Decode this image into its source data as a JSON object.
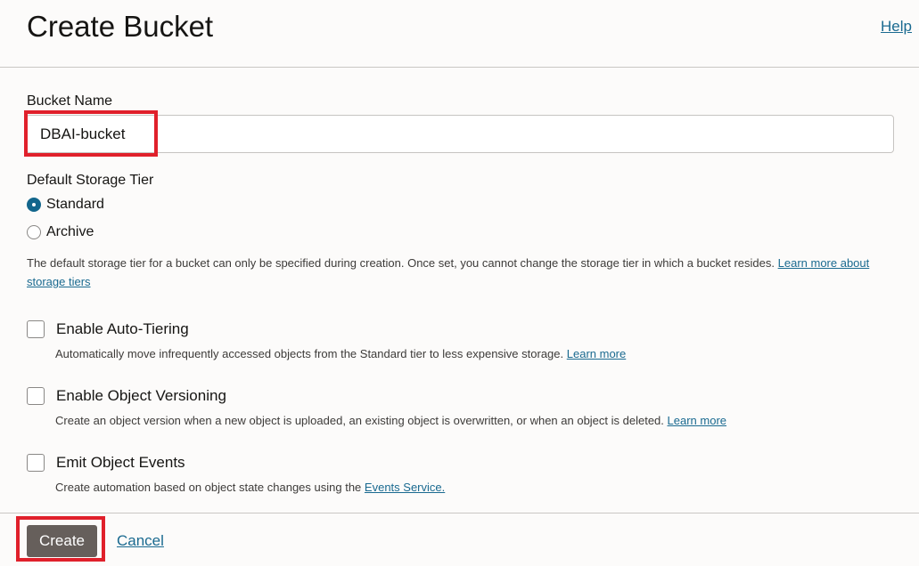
{
  "header": {
    "title": "Create Bucket",
    "help_label": "Help"
  },
  "bucket_name": {
    "label": "Bucket Name",
    "value": "DBAI-bucket"
  },
  "storage_tier": {
    "label": "Default Storage Tier",
    "options": [
      {
        "label": "Standard",
        "selected": true
      },
      {
        "label": "Archive",
        "selected": false
      }
    ],
    "description": "The default storage tier for a bucket can only be specified during creation. Once set, you cannot change the storage tier in which a bucket resides.",
    "learn_more": "Learn more about storage tiers"
  },
  "options": [
    {
      "label": "Enable Auto-Tiering",
      "checked": false,
      "description": "Automatically move infrequently accessed objects from the Standard tier to less expensive storage.",
      "link": "Learn more"
    },
    {
      "label": "Enable Object Versioning",
      "checked": false,
      "description": "Create an object version when a new object is uploaded, an existing object is overwritten, or when an object is deleted.",
      "link": "Learn more"
    },
    {
      "label": "Emit Object Events",
      "checked": false,
      "description": "Create automation based on object state changes using the",
      "link": "Events Service."
    }
  ],
  "footer": {
    "create_label": "Create",
    "cancel_label": "Cancel"
  },
  "colors": {
    "accent": "#13668c",
    "link": "#1a6a90",
    "primary_button": "#665f5b",
    "highlight": "#e0202b"
  }
}
